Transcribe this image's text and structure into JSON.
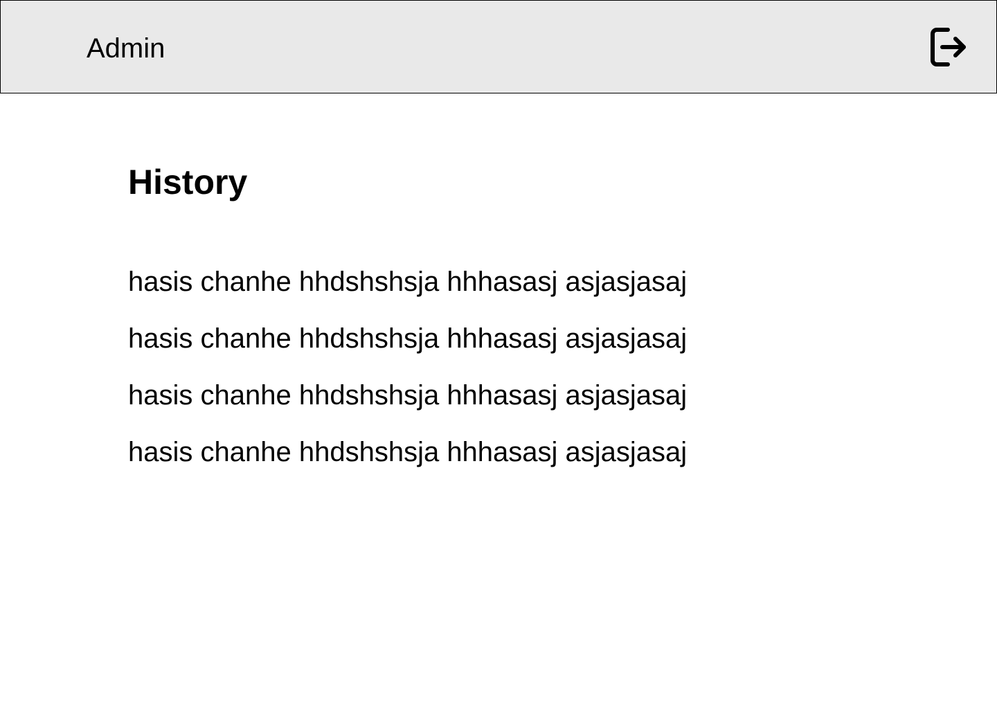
{
  "header": {
    "title": "Admin",
    "logout_icon": "logout-icon",
    "background": "#e9e9e9"
  },
  "main": {
    "title": "History",
    "items": [
      "hasis chanhe hhdshshsja hhhasasj asjasjasaj",
      "hasis chanhe hhdshshsja hhhasasj asjasjasaj",
      "hasis chanhe hhdshshsja hhhasasj asjasjasaj",
      "hasis chanhe hhdshshsja hhhasasj asjasjasaj"
    ]
  }
}
